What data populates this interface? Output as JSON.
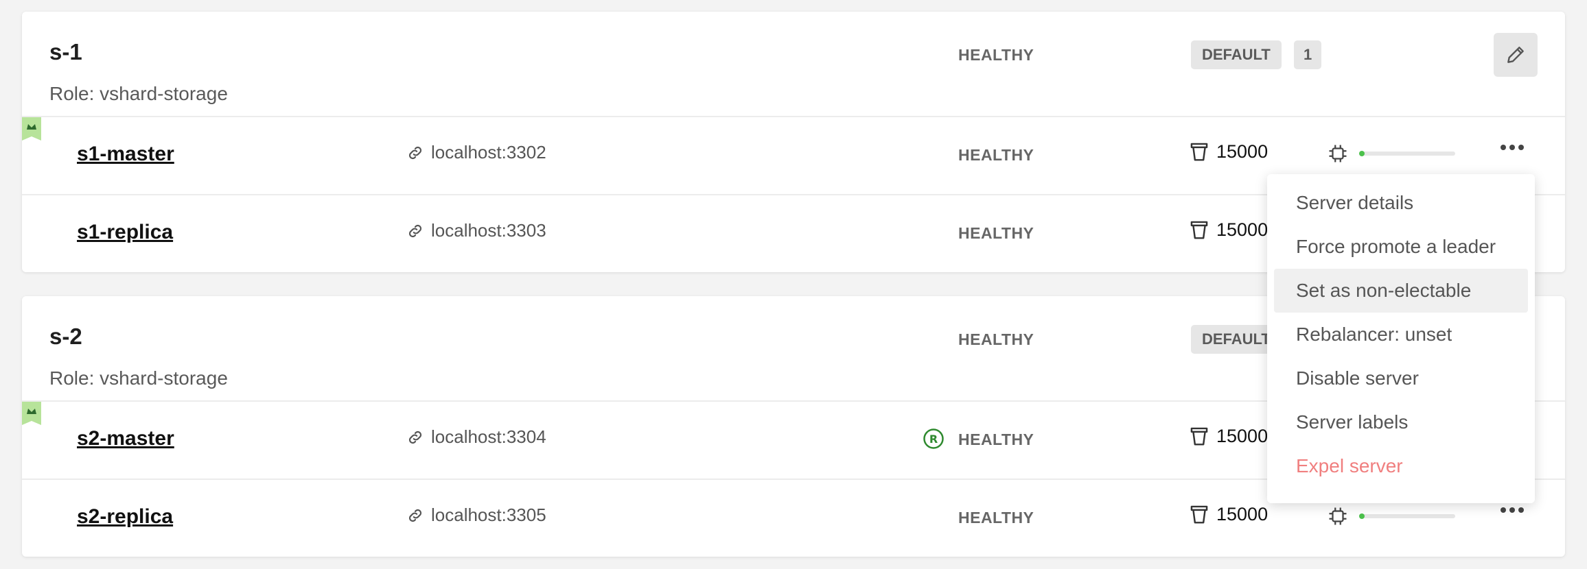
{
  "replicasets": [
    {
      "name": "s-1",
      "role": "Role: vshard-storage",
      "status": "HEALTHY",
      "group": "DEFAULT",
      "weight": "1",
      "servers": [
        {
          "name": "s1-master",
          "uri": "localhost:3302",
          "status": "HEALTHY",
          "buckets": "15000",
          "leader": true,
          "rebalancer": false
        },
        {
          "name": "s1-replica",
          "uri": "localhost:3303",
          "status": "HEALTHY",
          "buckets": "15000",
          "leader": false,
          "rebalancer": false
        }
      ]
    },
    {
      "name": "s-2",
      "role": "Role: vshard-storage",
      "status": "HEALTHY",
      "group": "DEFAULT",
      "servers": [
        {
          "name": "s2-master",
          "uri": "localhost:3304",
          "status": "HEALTHY",
          "buckets": "15000",
          "leader": true,
          "rebalancer": true
        },
        {
          "name": "s2-replica",
          "uri": "localhost:3305",
          "status": "HEALTHY",
          "buckets": "15000",
          "leader": false,
          "rebalancer": false
        }
      ]
    }
  ],
  "server_menu": {
    "items": [
      "Server details",
      "Force promote a leader",
      "Set as non-electable",
      "Rebalancer: unset",
      "Disable server",
      "Server labels",
      "Expel server"
    ],
    "highlighted_item": "Set as non-electable"
  },
  "icons": {
    "edit": "pencil-icon",
    "leader": "crown-flag-icon",
    "uri": "link-icon",
    "buckets": "bucket-icon",
    "memory": "chip-icon",
    "more": "more-dots-icon",
    "rebalancer": "rebalancer-r-icon"
  },
  "colors": {
    "leader_flag": "#b7e39a",
    "memory_fill": "#4cc14c",
    "danger": "#f07f7f",
    "rebalancer": "#2f8a2f"
  }
}
